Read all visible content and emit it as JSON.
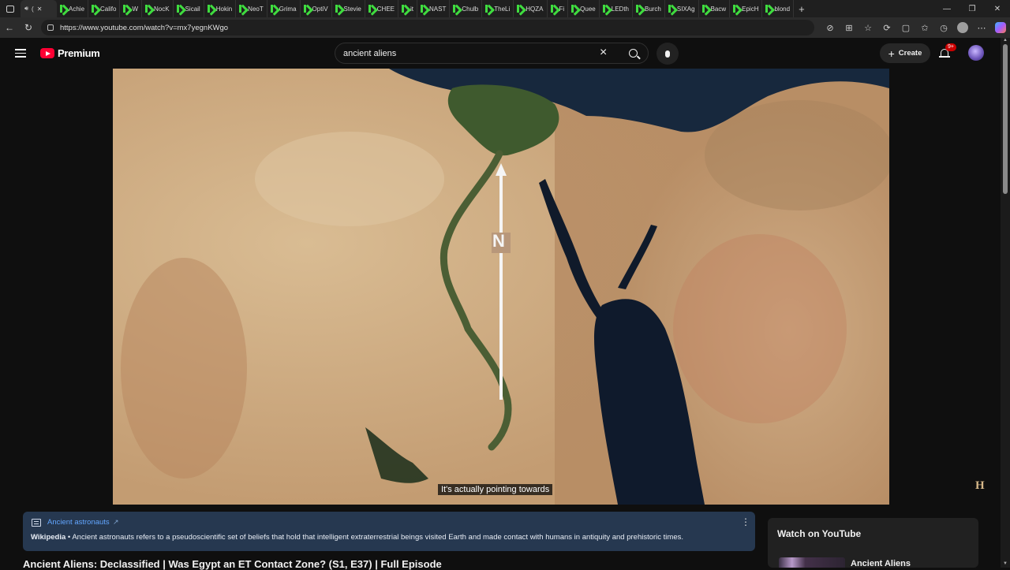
{
  "browser": {
    "active_tab_label": "(",
    "tabs": [
      "Achie",
      "Califo",
      "W",
      "NocK",
      "Sicail",
      "Hokin",
      "NeoT",
      "Grima",
      "OptiV",
      "Stevie",
      "CHEE",
      "it",
      "NAST",
      "Chulb",
      "TheLi",
      "HQZA",
      "Fi",
      "Quee",
      "LEDth",
      "Burch",
      "SIXAg",
      "Bacw",
      "EpicH",
      "blond"
    ],
    "url": "https://www.youtube.com/watch?v=mx7yegnKWgo"
  },
  "youtube": {
    "logo_text": "Premium",
    "search_value": "ancient aliens",
    "create_label": "Create",
    "notification_badge": "9+"
  },
  "player": {
    "caption": "It's actually pointing towards",
    "map_label": "N",
    "channel_mark": "H"
  },
  "info_panel": {
    "title": "Ancient astronauts",
    "source": "Wikipedia",
    "text": " • Ancient astronauts refers to a pseudoscientific set of beliefs that hold that intelligent extraterrestrial beings visited Earth and made contact with humans in antiquity and prehistoric times."
  },
  "video_title": "Ancient Aliens: Declassified | Was Egypt an ET Contact Zone? (S1, E37) | Full Episode",
  "watch_panel": {
    "title": "Watch on YouTube",
    "item_title": "Ancient Aliens"
  }
}
